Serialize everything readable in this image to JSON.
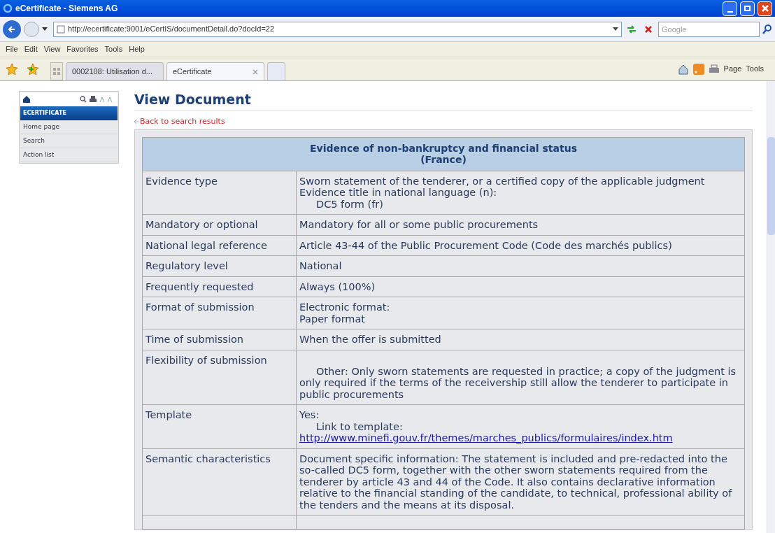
{
  "window": {
    "title": "eCertificate - Siemens AG"
  },
  "address_bar": {
    "url": "http://ecertificate:9001/eCertIS/documentDetail.do?docId=22",
    "search_placeholder": "Google"
  },
  "menu": [
    "File",
    "Edit",
    "View",
    "Favorites",
    "Tools",
    "Help"
  ],
  "tabs": [
    {
      "label": "0002108: Utilisation d...",
      "selected": false
    },
    {
      "label": "eCertificate",
      "selected": true
    }
  ],
  "command_bar": {
    "page": "Page",
    "tools": "Tools"
  },
  "sidebar": {
    "heading": "ECERTIFICATE",
    "items": [
      "Home page",
      "Search",
      "Action list"
    ]
  },
  "page": {
    "title": "View Document",
    "back_link": "Back to search results",
    "table": {
      "title": "Evidence of non-bankruptcy and financial status",
      "subtitle": "(France)",
      "rows": [
        {
          "label": "Evidence type",
          "lines": [
            {
              "kind": "plain",
              "text": "Sworn statement of the tenderer, or a certified copy of the applicable judgment"
            },
            {
              "kind": "plain",
              "text": "Evidence title in national language (n):"
            },
            {
              "kind": "indented",
              "text": "DC5 form (fr)"
            }
          ]
        },
        {
          "label": "Mandatory or optional",
          "lines": [
            {
              "kind": "plain",
              "text": "Mandatory for all or some public procurements"
            }
          ]
        },
        {
          "label": "National legal reference",
          "lines": [
            {
              "kind": "plain",
              "text": "Article 43-44 of the Public Procurement Code (Code des marchés publics)"
            }
          ]
        },
        {
          "label": "Regulatory level",
          "lines": [
            {
              "kind": "plain",
              "text": "National"
            }
          ]
        },
        {
          "label": "Frequently requested",
          "lines": [
            {
              "kind": "plain",
              "text": "Always (100%)"
            }
          ]
        },
        {
          "label": "Format of submission",
          "lines": [
            {
              "kind": "plain",
              "text": "Electronic format:"
            },
            {
              "kind": "plain",
              "text": "Paper format"
            }
          ]
        },
        {
          "label": "Time of submission",
          "lines": [
            {
              "kind": "plain",
              "text": "When the offer is submitted"
            }
          ]
        },
        {
          "label": "Flexibility of submission",
          "lines": [
            {
              "kind": "indented",
              "text": "Other: Only sworn statements are requested in practice; a copy of the judgment is only required if the terms of the receivership still allow the tenderer to participate in public procurements"
            }
          ]
        },
        {
          "label": "Template",
          "lines": [
            {
              "kind": "plain",
              "text": "Yes:"
            },
            {
              "kind": "indented",
              "text": "Link to template:"
            },
            {
              "kind": "link",
              "text": "http://www.minefi.gouv.fr/themes/marches_publics/formulaires/index.htm"
            }
          ]
        },
        {
          "label": "Semantic characteristics",
          "lines": [
            {
              "kind": "plain",
              "text": "Document specific information: The statement is included and pre-redacted into the so-called DC5 form, together with the other sworn statements required from the tenderer by article 43 and 44 of the Code. It also contains declarative information relative to the financial standing of the candidate, to technical, professional ability of the tenders and the means at its disposal."
            }
          ]
        }
      ]
    }
  }
}
